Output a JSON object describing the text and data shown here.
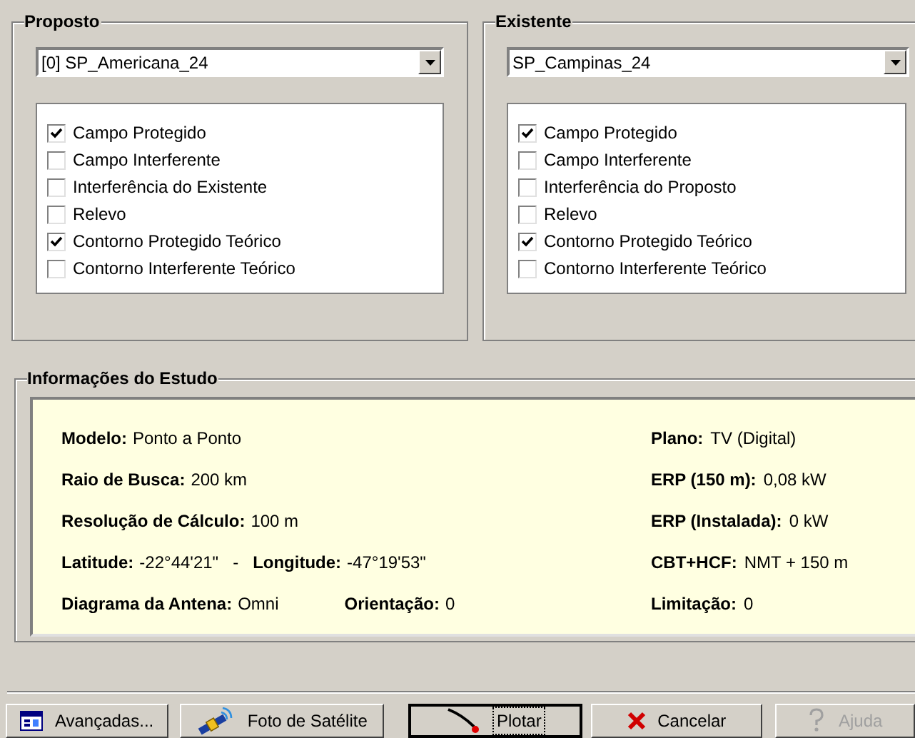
{
  "panels": [
    {
      "title": "Proposto",
      "dropdown": {
        "value": "[0] SP_Americana_24"
      },
      "options": [
        {
          "label": "Campo Protegido",
          "checked": true
        },
        {
          "label": "Campo Interferente",
          "checked": false
        },
        {
          "label": "Interferência do Existente",
          "checked": false
        },
        {
          "label": "Relevo",
          "checked": false
        },
        {
          "label": "Contorno Protegido Teórico",
          "checked": true
        },
        {
          "label": "Contorno Interferente Teórico",
          "checked": false
        }
      ]
    },
    {
      "title": "Existente",
      "dropdown": {
        "value": "SP_Campinas_24"
      },
      "options": [
        {
          "label": "Campo Protegido",
          "checked": true
        },
        {
          "label": "Campo Interferente",
          "checked": false
        },
        {
          "label": "Interferência do Proposto",
          "checked": false
        },
        {
          "label": "Relevo",
          "checked": false
        },
        {
          "label": "Contorno Protegido Teórico",
          "checked": true
        },
        {
          "label": "Contorno Interferente Teórico",
          "checked": false
        }
      ]
    }
  ],
  "info": {
    "title": "Informações do Estudo",
    "rows": [
      {
        "left": [
          {
            "kind": "pair",
            "label": "Modelo:",
            "value": "Ponto a Ponto"
          }
        ],
        "right": {
          "label": "Plano:",
          "value": "TV (Digital)"
        }
      },
      {
        "left": [
          {
            "kind": "pair",
            "label": "Raio de Busca:",
            "value": "200 km"
          }
        ],
        "right": {
          "label": "ERP (150 m):",
          "value": "0,08 kW"
        }
      },
      {
        "left": [
          {
            "kind": "pair",
            "label": "Resolução de Cálculo:",
            "value": "100 m"
          }
        ],
        "right": {
          "label": "ERP (Instalada):",
          "value": "0 kW"
        }
      },
      {
        "left": [
          {
            "kind": "pair",
            "label": "Latitude:",
            "value": "-22°44'21\""
          },
          {
            "kind": "separator",
            "text": "-"
          },
          {
            "kind": "pair",
            "label": "Longitude:",
            "value": "-47°19'53\""
          }
        ],
        "right": {
          "label": "CBT+HCF:",
          "value": "NMT + 150 m"
        }
      },
      {
        "left": [
          {
            "kind": "pair",
            "label": "Diagrama da Antena:",
            "value": "Omni"
          },
          {
            "kind": "gap"
          },
          {
            "kind": "pair",
            "label": "Orientação:",
            "value": "0"
          }
        ],
        "right": {
          "label": "Limitação:",
          "value": "0"
        }
      }
    ]
  },
  "buttons": [
    {
      "label": "Avançadas...",
      "kind": "window",
      "default": false,
      "disabled": false
    },
    {
      "label": "Foto de Satélite",
      "kind": "satellite",
      "default": false,
      "disabled": false
    },
    {
      "label": "Plotar",
      "kind": "pen",
      "default": true,
      "disabled": false
    },
    {
      "label": "Cancelar",
      "kind": "x",
      "default": false,
      "disabled": false
    },
    {
      "label": "Ajuda",
      "kind": "help",
      "default": false,
      "disabled": true
    }
  ]
}
